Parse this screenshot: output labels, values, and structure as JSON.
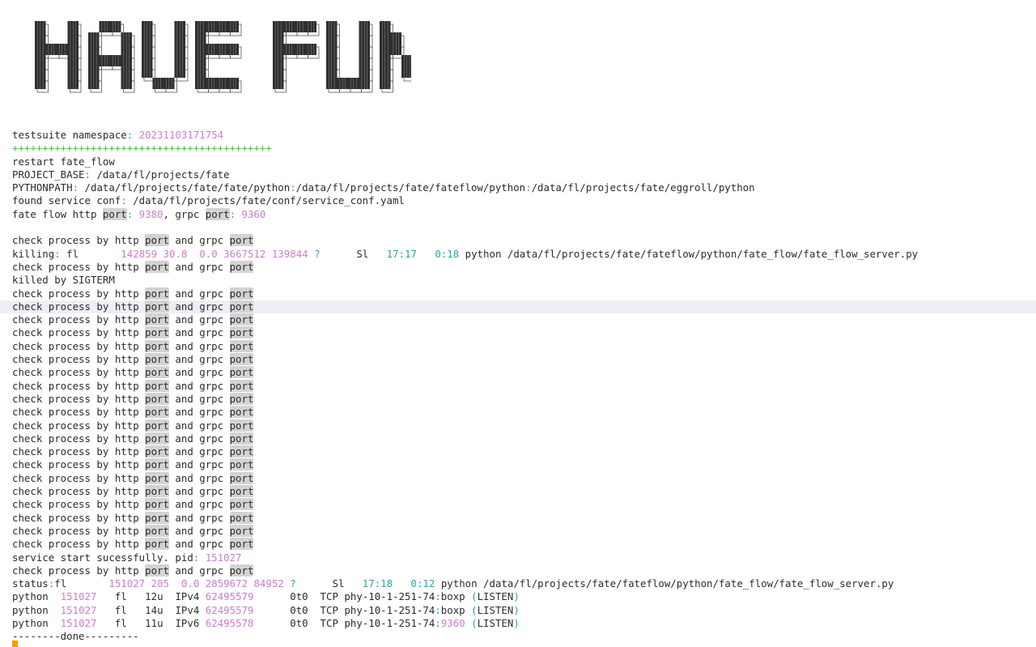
{
  "banner": {
    "text": "HAVE FUN"
  },
  "terminal": {
    "port_word": "port",
    "check_a": "check process by http ",
    "check_b": " and grpc ",
    "lines": [
      {
        "type": "kv",
        "key": "testsuite namespace",
        "sep": ": ",
        "val": "20231103171754"
      },
      {
        "type": "plus",
        "text": "+++++++++++++++++++++++++++++++++++++++++++"
      },
      {
        "type": "text",
        "text": "restart fate_flow"
      },
      {
        "type": "kv",
        "key": "PROJECT_BASE",
        "sep": ": ",
        "val": "/data/fl/projects/fate",
        "valplain": true
      },
      {
        "type": "pythonpath",
        "key": "PYTHONPATH",
        "parts": [
          "/data/fl/projects/fate/fate/python",
          "/data/fl/projects/fate/fateflow/python",
          "/data/fl/projects/fate/eggroll/python"
        ]
      },
      {
        "type": "kv",
        "key": "found service conf",
        "sep": ": ",
        "val": "/data/fl/projects/fate/conf/service_conf.yaml",
        "valplain": true
      },
      {
        "type": "ports",
        "a": "fate flow http ",
        "http_port": "9380",
        "b": ", grpc ",
        "grpc_port": "9360"
      },
      {
        "type": "blank"
      },
      {
        "type": "check"
      },
      {
        "type": "ps",
        "prefix": "killing",
        "user": "fl",
        "pid": "142859",
        "cpu": "30.8",
        "mem": "0.0",
        "vsz": "3667512",
        "rss": "139844",
        "tty": "?",
        "stat": "Sl",
        "start": "17:17",
        "time": "0:18",
        "cmd": "python /data/fl/projects/fate/fateflow/python/fate_flow/fate_flow_server.py"
      },
      {
        "type": "check"
      },
      {
        "type": "text",
        "text": "killed by SIGTERM"
      },
      {
        "type": "check"
      },
      {
        "type": "check",
        "hl": true
      },
      {
        "type": "check"
      },
      {
        "type": "check"
      },
      {
        "type": "check"
      },
      {
        "type": "check"
      },
      {
        "type": "check"
      },
      {
        "type": "check"
      },
      {
        "type": "check"
      },
      {
        "type": "check"
      },
      {
        "type": "check"
      },
      {
        "type": "check"
      },
      {
        "type": "check"
      },
      {
        "type": "check"
      },
      {
        "type": "check"
      },
      {
        "type": "check"
      },
      {
        "type": "check"
      },
      {
        "type": "check"
      },
      {
        "type": "check"
      },
      {
        "type": "check"
      },
      {
        "type": "pid",
        "text": "service start sucessfully. pid",
        "val": "151027"
      },
      {
        "type": "check"
      },
      {
        "type": "ps",
        "prefix": "status",
        "user": "fl",
        "pid": "151027",
        "cpu": "205",
        "mem": "0.0",
        "vsz": "2859672",
        "rss": "84952",
        "tty": "?",
        "stat": "Sl",
        "start": "17:18",
        "time": "0:12",
        "cmd": "python /data/fl/projects/fate/fateflow/python/fate_flow/fate_flow_server.py"
      },
      {
        "type": "lsof",
        "cmd": "python",
        "pid": "151027",
        "user": "fl",
        "fd": "12u",
        "proto": "IPv4",
        "dev": "62495579",
        "off": "0t0",
        "net": "TCP",
        "host": "phy-10-1-251-74",
        "port": "boxp",
        "state": "LISTEN"
      },
      {
        "type": "lsof",
        "cmd": "python",
        "pid": "151027",
        "user": "fl",
        "fd": "14u",
        "proto": "IPv4",
        "dev": "62495579",
        "off": "0t0",
        "net": "TCP",
        "host": "phy-10-1-251-74",
        "port": "boxp",
        "state": "LISTEN"
      },
      {
        "type": "lsof",
        "cmd": "python",
        "pid": "151027",
        "user": "fl",
        "fd": "11u",
        "proto": "IPv6",
        "dev": "62495578",
        "off": "0t0",
        "net": "TCP",
        "host": "phy-10-1-251-74",
        "port": "9360",
        "state": "LISTEN",
        "portmag": true
      },
      {
        "type": "done",
        "text": "--------done---------"
      }
    ]
  },
  "colors": {
    "magenta": "#cc7ecc",
    "cyan": "#2aa5a5",
    "green": "#4cb84c",
    "cursor": "#f0a000"
  }
}
